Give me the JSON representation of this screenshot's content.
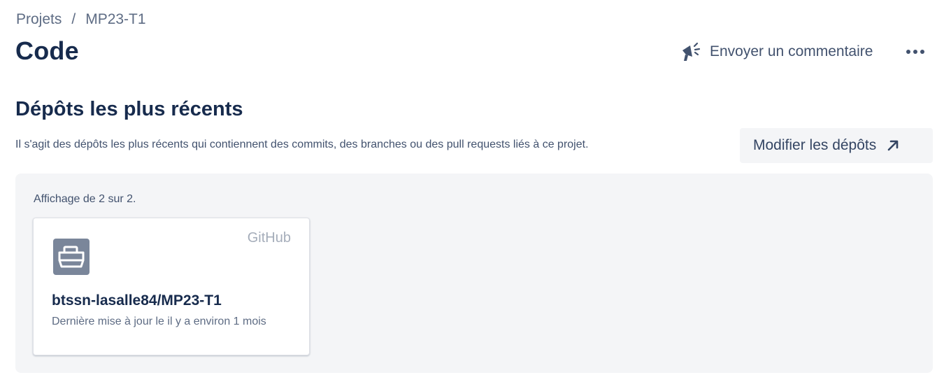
{
  "breadcrumb": {
    "items": [
      "Projets",
      "MP23-T1"
    ],
    "separator": "/"
  },
  "page": {
    "title": "Code"
  },
  "header_actions": {
    "feedback_label": "Envoyer un commentaire",
    "feedback_icon": "megaphone-icon",
    "more_icon": "more-horizontal-icon"
  },
  "section": {
    "title": "Dépôts les plus récents",
    "description": "Il s'agit des dépôts les plus récents qui contiennent des commits, des branches ou des pull requests liés à ce projet.",
    "edit_button_label": "Modifier les dépôts",
    "edit_button_icon": "arrow-up-right-icon"
  },
  "repositories": {
    "count_text": "Affichage de 2 sur 2.",
    "items": [
      {
        "provider": "GitHub",
        "icon": "repository-boat-icon",
        "name": "btssn-lasalle84/MP23-T1",
        "updated": "Dernière mise à jour le il y a environ 1 mois"
      }
    ]
  },
  "colors": {
    "text_primary": "#172b4d",
    "text_secondary": "#42526e",
    "panel_bg": "#f4f5f7",
    "repo_icon_bg": "#7a869a"
  }
}
